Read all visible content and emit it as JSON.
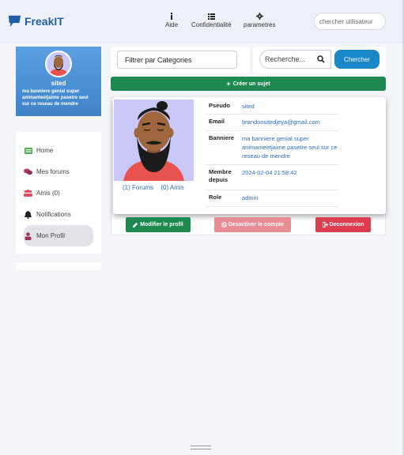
{
  "brand": {
    "name": "FreakIT",
    "logo_icon": "chat-bubble-icon",
    "color": "#1f5fa8"
  },
  "topnav": [
    {
      "label": "Aide",
      "icon": "info-icon"
    },
    {
      "label": "Confidentialité",
      "icon": "list-icon"
    },
    {
      "label": "parametres",
      "icon": "gear-icon"
    }
  ],
  "user_search": {
    "placeholder": "chercher utilisateur"
  },
  "profile_card": {
    "username": "sited",
    "banner": "ma banniere genial super animanteetjaime pasetre seul sur ce reseau de mendre"
  },
  "sidebar": {
    "items": [
      {
        "label": "Home",
        "icon": "home-icon"
      },
      {
        "label": "Mes forums",
        "icon": "comments-icon"
      },
      {
        "label": "Amis (0)",
        "icon": "users-icon"
      },
      {
        "label": "Notifications",
        "icon": "bell-icon"
      },
      {
        "label": "Mon Profil",
        "icon": "user-icon",
        "active": true
      }
    ]
  },
  "filter": {
    "label": "Filtrer par Categories"
  },
  "search": {
    "placeholder": "Recherche...",
    "button": "Chercher"
  },
  "create_topic": {
    "label": "Créer un sujet"
  },
  "profile": {
    "links": {
      "forums": "(1) Forums",
      "friends": "(0) Amis"
    },
    "fields": [
      {
        "key": "Pseudo",
        "value": "sited"
      },
      {
        "key": "Email",
        "value": "brandonsitedjeya@gmail.com"
      },
      {
        "key": "Banniere",
        "value": "ma banniere genial super animanteetjaime pasetre seul sur ce reseau de mendre"
      },
      {
        "key": "Membre depuis",
        "value": "2024-02-04 21:58:42"
      },
      {
        "key": "Role",
        "value": "admin"
      }
    ]
  },
  "actions": {
    "edit": "Modifier le profil",
    "deactivate": "Desactiver le compte",
    "logout": "Deconnexion"
  },
  "colors": {
    "accent_blue": "#1a87c9",
    "green": "#1f8a50",
    "red": "#dc3d50",
    "pink": "#ea8c93",
    "card_blue": "#4c90d6"
  }
}
